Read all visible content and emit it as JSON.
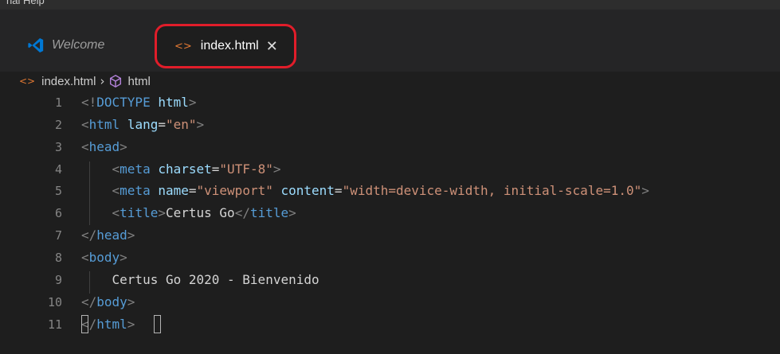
{
  "title_strip": {
    "menu_fragment": "nal   Help"
  },
  "tabs": [
    {
      "label": "Welcome",
      "icon": "vscode-logo-icon"
    },
    {
      "label": "index.html",
      "icon": "html-file-icon",
      "close_glyph": "✕"
    }
  ],
  "breadcrumb": {
    "file": "index.html",
    "separator": "›",
    "symbol": "html"
  },
  "editor": {
    "line_numbers": [
      "1",
      "2",
      "3",
      "4",
      "5",
      "6",
      "7",
      "8",
      "9",
      "10",
      "11"
    ],
    "lines": [
      [
        {
          "t": "punc",
          "v": "<!"
        },
        {
          "t": "tag",
          "v": "DOCTYPE"
        },
        {
          "t": "text",
          "v": " "
        },
        {
          "t": "attr",
          "v": "html"
        },
        {
          "t": "punc",
          "v": ">"
        }
      ],
      [
        {
          "t": "punc",
          "v": "<"
        },
        {
          "t": "tag",
          "v": "html"
        },
        {
          "t": "text",
          "v": " "
        },
        {
          "t": "attr",
          "v": "lang"
        },
        {
          "t": "text",
          "v": "="
        },
        {
          "t": "str",
          "v": "\"en\""
        },
        {
          "t": "punc",
          "v": ">"
        }
      ],
      [
        {
          "t": "punc",
          "v": "<"
        },
        {
          "t": "tag",
          "v": "head"
        },
        {
          "t": "punc",
          "v": ">"
        }
      ],
      [
        {
          "t": "text",
          "v": "    "
        },
        {
          "t": "punc",
          "v": "<"
        },
        {
          "t": "tag",
          "v": "meta"
        },
        {
          "t": "text",
          "v": " "
        },
        {
          "t": "attr",
          "v": "charset"
        },
        {
          "t": "text",
          "v": "="
        },
        {
          "t": "str",
          "v": "\"UTF-8\""
        },
        {
          "t": "punc",
          "v": ">"
        }
      ],
      [
        {
          "t": "text",
          "v": "    "
        },
        {
          "t": "punc",
          "v": "<"
        },
        {
          "t": "tag",
          "v": "meta"
        },
        {
          "t": "text",
          "v": " "
        },
        {
          "t": "attr",
          "v": "name"
        },
        {
          "t": "text",
          "v": "="
        },
        {
          "t": "str",
          "v": "\"viewport\""
        },
        {
          "t": "text",
          "v": " "
        },
        {
          "t": "attr",
          "v": "content"
        },
        {
          "t": "text",
          "v": "="
        },
        {
          "t": "str",
          "v": "\"width=device-width, initial-scale=1.0\""
        },
        {
          "t": "punc",
          "v": ">"
        }
      ],
      [
        {
          "t": "text",
          "v": "    "
        },
        {
          "t": "punc",
          "v": "<"
        },
        {
          "t": "tag",
          "v": "title"
        },
        {
          "t": "punc",
          "v": ">"
        },
        {
          "t": "text",
          "v": "Certus Go"
        },
        {
          "t": "punc",
          "v": "</"
        },
        {
          "t": "tag",
          "v": "title"
        },
        {
          "t": "punc",
          "v": ">"
        }
      ],
      [
        {
          "t": "punc",
          "v": "</"
        },
        {
          "t": "tag",
          "v": "head"
        },
        {
          "t": "punc",
          "v": ">"
        }
      ],
      [
        {
          "t": "punc",
          "v": "<"
        },
        {
          "t": "tag",
          "v": "body"
        },
        {
          "t": "punc",
          "v": ">"
        }
      ],
      [
        {
          "t": "text",
          "v": "    Certus Go 2020 - Bienvenido"
        }
      ],
      [
        {
          "t": "punc",
          "v": "</"
        },
        {
          "t": "tag",
          "v": "body"
        },
        {
          "t": "punc",
          "v": ">"
        }
      ],
      [
        {
          "t": "punc",
          "v": "</"
        },
        {
          "t": "tag",
          "v": "html"
        },
        {
          "t": "punc",
          "v": ">"
        }
      ]
    ]
  },
  "colors": {
    "editor_bg": "#1e1e1e",
    "tab_bar_bg": "#252526",
    "tag": "#569cd6",
    "attribute": "#9cdcfe",
    "string": "#ce9178",
    "punctuation": "#808080",
    "line_number": "#858585",
    "highlight_border": "#e11d2a",
    "html_icon": "#e37933"
  }
}
